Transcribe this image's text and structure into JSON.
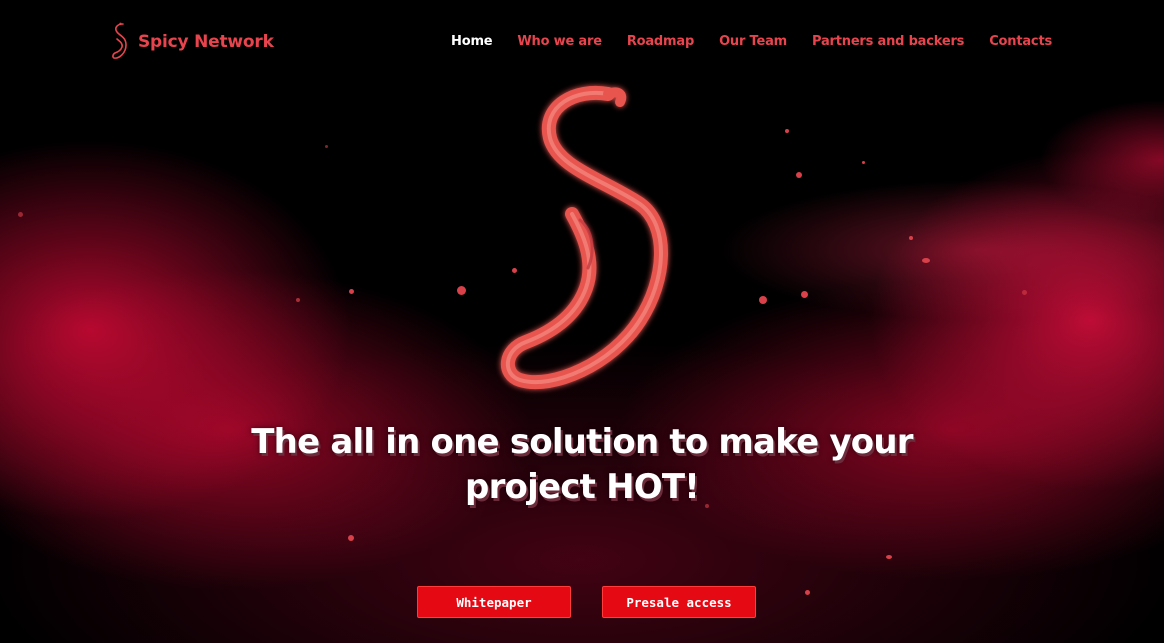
{
  "brand": {
    "name": "Spicy Network",
    "logo_icon": "chili-s-logo-icon"
  },
  "nav": {
    "items": [
      {
        "label": "Home",
        "active": true
      },
      {
        "label": "Who we are",
        "active": false
      },
      {
        "label": "Roadmap",
        "active": false
      },
      {
        "label": "Our Team",
        "active": false
      },
      {
        "label": "Partners and backers",
        "active": false
      },
      {
        "label": "Contacts",
        "active": false
      }
    ]
  },
  "hero": {
    "logo_icon": "chili-s-logo-icon",
    "headline_line1": "The all in one solution to make your",
    "headline_line2": "project HOT!"
  },
  "buttons": {
    "whitepaper_label": "Whitepaper",
    "presale_label": "Presale access"
  },
  "colors": {
    "accent": "#e8444d",
    "button_bg": "#e50914",
    "background": "#000000",
    "smoke": "#d20a37"
  }
}
